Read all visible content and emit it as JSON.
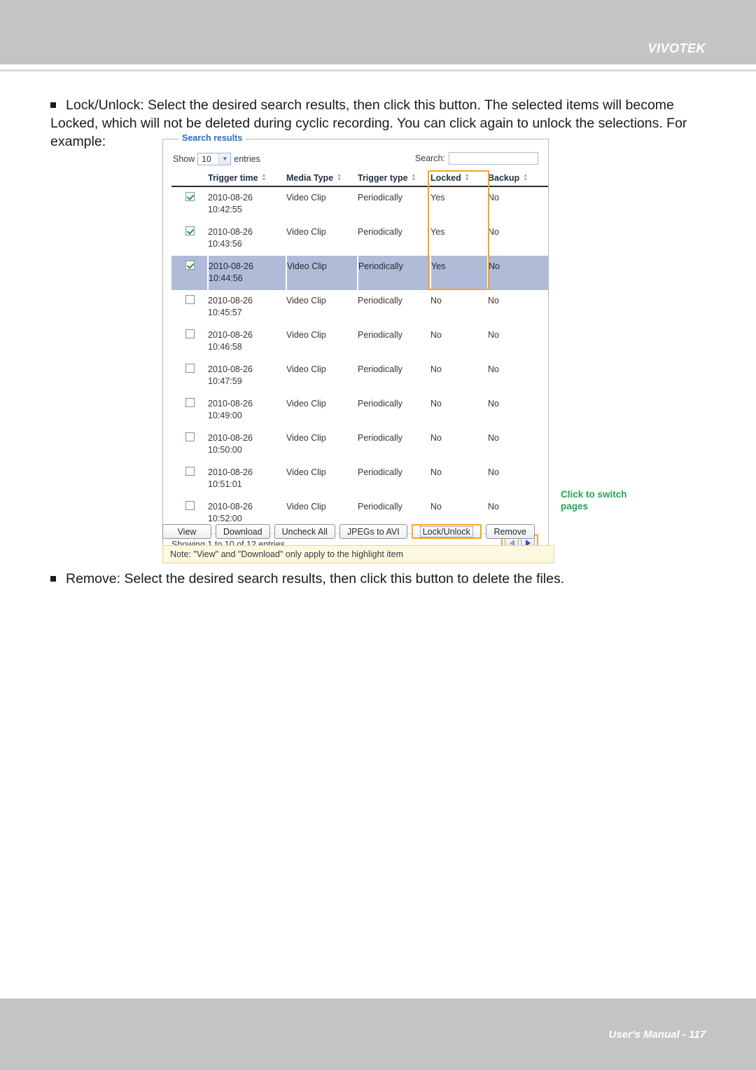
{
  "header": {
    "brand": "VIVOTEK"
  },
  "footer": {
    "text": "User's Manual - 117"
  },
  "paragraphs": {
    "lock_unlock": "Lock/Unlock: Select the desired search results, then click this button. The selected items will become Locked, which will not be deleted during cyclic recording. You can click again to unlock the selections. For example:",
    "remove": "Remove: Select the desired search results, then click this button to delete the files."
  },
  "panel": {
    "legend": "Search results",
    "show_label": "Show",
    "entries_value": "10",
    "entries_label": "entries",
    "search_label": "Search:",
    "search_value": "",
    "search_placeholder": "",
    "columns": [
      {
        "label": "",
        "key": "checkbox"
      },
      {
        "label": "Trigger time",
        "key": "trigger_time"
      },
      {
        "label": "Media Type",
        "key": "media_type"
      },
      {
        "label": "Trigger type",
        "key": "trigger_type"
      },
      {
        "label": "Locked",
        "key": "locked"
      },
      {
        "label": "Backup",
        "key": "backup"
      }
    ],
    "rows": [
      {
        "checked": true,
        "highlighted": false,
        "date": "2010-08-26",
        "time": "10:42:55",
        "media_type": "Video Clip",
        "trigger_type": "Periodically",
        "locked": "Yes",
        "backup": "No"
      },
      {
        "checked": true,
        "highlighted": false,
        "date": "2010-08-26",
        "time": "10:43:56",
        "media_type": "Video Clip",
        "trigger_type": "Periodically",
        "locked": "Yes",
        "backup": "No"
      },
      {
        "checked": true,
        "highlighted": true,
        "date": "2010-08-26",
        "time": "10:44:56",
        "media_type": "Video Clip",
        "trigger_type": "Periodically",
        "locked": "Yes",
        "backup": "No"
      },
      {
        "checked": false,
        "highlighted": false,
        "date": "2010-08-26",
        "time": "10:45:57",
        "media_type": "Video Clip",
        "trigger_type": "Periodically",
        "locked": "No",
        "backup": "No"
      },
      {
        "checked": false,
        "highlighted": false,
        "date": "2010-08-26",
        "time": "10:46:58",
        "media_type": "Video Clip",
        "trigger_type": "Periodically",
        "locked": "No",
        "backup": "No"
      },
      {
        "checked": false,
        "highlighted": false,
        "date": "2010-08-26",
        "time": "10:47:59",
        "media_type": "Video Clip",
        "trigger_type": "Periodically",
        "locked": "No",
        "backup": "No"
      },
      {
        "checked": false,
        "highlighted": false,
        "date": "2010-08-26",
        "time": "10:49:00",
        "media_type": "Video Clip",
        "trigger_type": "Periodically",
        "locked": "No",
        "backup": "No"
      },
      {
        "checked": false,
        "highlighted": false,
        "date": "2010-08-26",
        "time": "10:50:00",
        "media_type": "Video Clip",
        "trigger_type": "Periodically",
        "locked": "No",
        "backup": "No"
      },
      {
        "checked": false,
        "highlighted": false,
        "date": "2010-08-26",
        "time": "10:51:01",
        "media_type": "Video Clip",
        "trigger_type": "Periodically",
        "locked": "No",
        "backup": "No"
      },
      {
        "checked": false,
        "highlighted": false,
        "date": "2010-08-26",
        "time": "10:52:00",
        "media_type": "Video Clip",
        "trigger_type": "Periodically",
        "locked": "No",
        "backup": "No"
      }
    ],
    "showing_text": "Showing 1 to 10 of 12 entries",
    "pager": {
      "prev_icon": "triangle-left-icon",
      "next_icon": "triangle-right-icon",
      "prev_enabled": false,
      "next_enabled": true
    }
  },
  "buttons": [
    {
      "label": "View",
      "focused": false
    },
    {
      "label": "Download",
      "focused": false
    },
    {
      "label": "Uncheck All",
      "focused": false
    },
    {
      "label": "JPEGs to AVI",
      "focused": false
    },
    {
      "label": "Lock/Unlock",
      "focused": true
    },
    {
      "label": "Remove",
      "focused": false
    }
  ],
  "note": "Note: \"View\" and \"Download\" only apply to the highlight item",
  "callout": "Click to switch pages",
  "colors": {
    "header_band": "#c3c5c5",
    "legend_blue": "#2b6fc0",
    "highlight_orange": "#f5a623",
    "row_highlight": "#b0bbd8",
    "callout_green": "#23a455",
    "note_bg": "#fdf8e0"
  }
}
